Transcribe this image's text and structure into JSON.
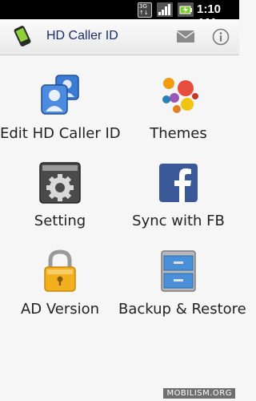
{
  "status_bar": {
    "network_type_top": "3G",
    "network_type_bottom": "↑↓",
    "time": "1:10",
    "time_suffix": "AM"
  },
  "title_bar": {
    "title": "HD Caller ID",
    "icons": [
      "phone-app-icon",
      "mail-icon",
      "info-icon"
    ]
  },
  "menu": {
    "items": [
      {
        "label": "Edit HD Caller ID",
        "icon": "contacts-icon"
      },
      {
        "label": "Themes",
        "icon": "themes-paint-icon"
      },
      {
        "label": "Setting",
        "icon": "gear-icon"
      },
      {
        "label": "Sync with FB",
        "icon": "facebook-icon"
      },
      {
        "label": "AD Version",
        "icon": "lock-icon"
      },
      {
        "label": "Backup & Restore",
        "icon": "cabinet-icon"
      }
    ]
  },
  "watermark": "MOBILISM.ORG",
  "colors": {
    "title_text": "#1a2d6b",
    "facebook_blue": "#3b5998",
    "lock_gold": "#f2b01e"
  }
}
